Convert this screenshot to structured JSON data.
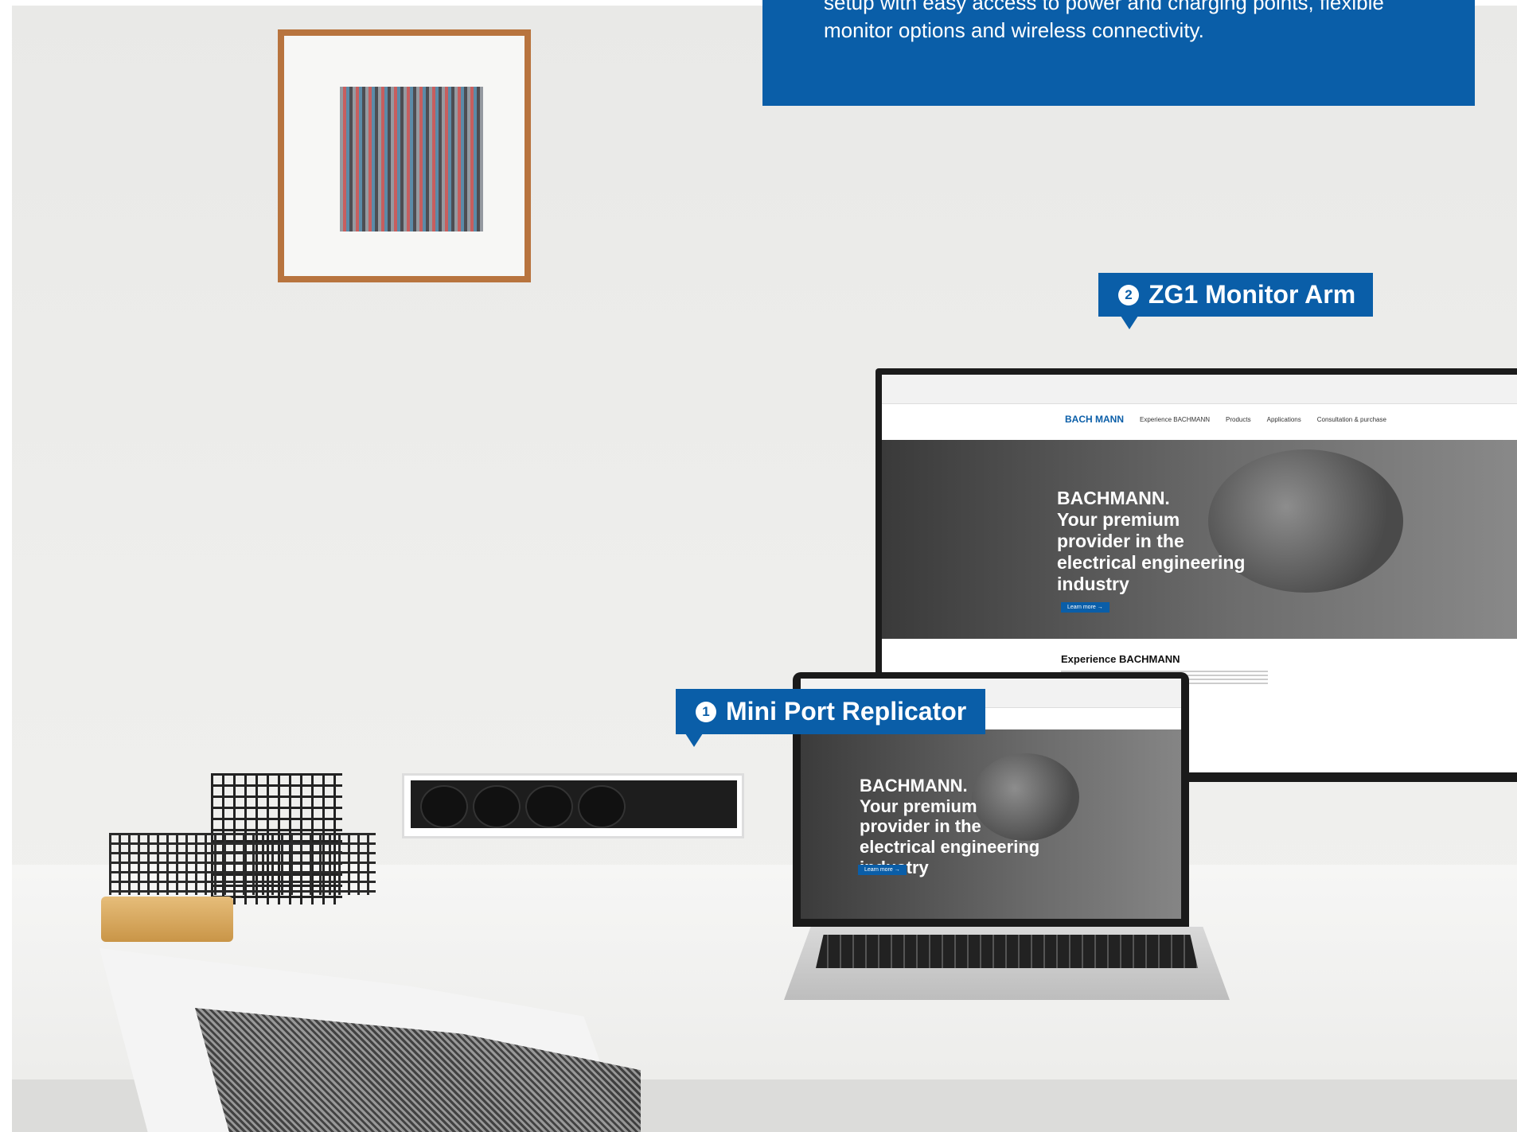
{
  "intro": {
    "text": "setup with easy access to power and charging points, flexible monitor options and wireless connectivity."
  },
  "labels": [
    {
      "number": "1",
      "text": "Mini Port Replicator"
    },
    {
      "number": "2",
      "text": "ZG1 Monitor Arm"
    }
  ],
  "screen": {
    "logo": "BACH MANN",
    "nav": [
      "Experience BACHMANN",
      "Products",
      "Applications",
      "Consultation & purchase"
    ],
    "hero_lines": [
      "BACHMANN.",
      "Your premium",
      "provider in the",
      "electrical engineering",
      "industry"
    ],
    "button": "Learn more →",
    "section_title": "Experience BACHMANN"
  },
  "laptop": {
    "hero_lines": [
      "BACHMANN.",
      "Your premium",
      "provider in the",
      "electrical engineering",
      "industry"
    ],
    "button": "Learn more →"
  },
  "colors": {
    "accent": "#0a5ea8"
  }
}
